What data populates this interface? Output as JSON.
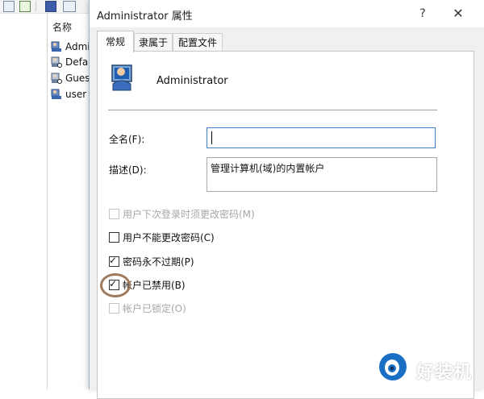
{
  "background_window": {
    "column_header": "名称",
    "users": [
      "Admini",
      "Defau",
      "Gues",
      "user"
    ]
  },
  "dialog": {
    "title": "Administrator 属性",
    "help_label": "?",
    "close_label": "✕",
    "tabs": [
      "常规",
      "隶属于",
      "配置文件"
    ],
    "active_tab": "常规",
    "user_name": "Administrator",
    "fullname_label": "全名(F):",
    "fullname_value": "",
    "description_label": "描述(D):",
    "description_value": "管理计算机(域)的内置帐户",
    "checkboxes": [
      {
        "label": "用户下次登录时须更改密码(M)",
        "checked": false,
        "enabled": false
      },
      {
        "label": "用户不能更改密码(C)",
        "checked": false,
        "enabled": true
      },
      {
        "label": "密码永不过期(P)",
        "checked": true,
        "enabled": true
      },
      {
        "label": "帐户已禁用(B)",
        "checked": true,
        "enabled": true
      },
      {
        "label": "帐户已锁定(O)",
        "checked": false,
        "enabled": false
      }
    ]
  },
  "watermark": {
    "text": "好装机"
  },
  "colors": {
    "focus_border": "#3c7fc6",
    "highlight_circle": "#a07a5c",
    "disabled_text": "#a6a6a6",
    "watermark_blue": "#1a6fc4"
  }
}
